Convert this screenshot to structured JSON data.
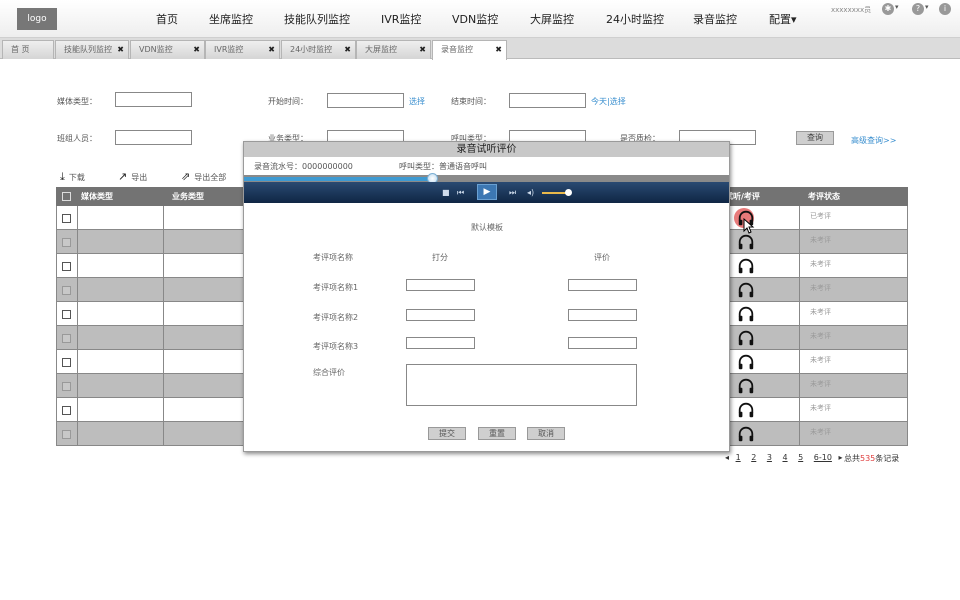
{
  "logo": "logo",
  "nav": [
    "首页",
    "坐席监控",
    "技能队列监控",
    "IVR监控",
    "VDN监控",
    "大屏监控",
    "24小时监控",
    "录音监控",
    "配置▾"
  ],
  "top": {
    "user": "xxxxxxxx员"
  },
  "tabs": [
    {
      "label": "首 页",
      "closable": false
    },
    {
      "label": "技能队列监控",
      "closable": true
    },
    {
      "label": "VDN监控",
      "closable": true
    },
    {
      "label": "IVR监控",
      "closable": true
    },
    {
      "label": "24小时监控",
      "closable": true
    },
    {
      "label": "大屏监控",
      "closable": true
    },
    {
      "label": "录音监控",
      "closable": true,
      "active": true
    }
  ],
  "close_glyph": "✖",
  "filters": {
    "media_type": "媒体类型：",
    "start_time": "开始时间：",
    "select": "选择",
    "end_time": "结束时间：",
    "today_select": "今天|选择",
    "team_member": "班组人员：",
    "business_type": "业务类型：",
    "call_type": "呼叫类型：",
    "qc": "是否质检：",
    "query": "查询",
    "advanced": "高级查询>>"
  },
  "toolbar": {
    "download": "下载",
    "export": "导出",
    "export_all": "导出全部"
  },
  "table": {
    "headers": [
      "媒体类型",
      "业务类型",
      "试听/考评",
      "考评状态"
    ],
    "rows": [
      {
        "status": "已考评"
      },
      {
        "status": "未考评"
      },
      {
        "status": "未考评"
      },
      {
        "status": "未考评"
      },
      {
        "status": "未考评"
      },
      {
        "status": "未考评"
      },
      {
        "status": "未考评"
      },
      {
        "status": "未考评"
      },
      {
        "status": "未考评"
      },
      {
        "status": "未考评"
      }
    ]
  },
  "pager": {
    "prev": "◂",
    "pages": [
      "1",
      "2",
      "3",
      "4",
      "5",
      "6-10"
    ],
    "next": "▸",
    "total_prefix": "总共",
    "total_count": "535",
    "total_suffix": "条记录"
  },
  "modal": {
    "title": "录音试听评价",
    "serial": "录音流水号：0000000000",
    "call_type": "呼叫类型：普通语音呼叫",
    "progress": 0.39,
    "template": "默认模板",
    "col_name": "考评项名称",
    "col_score": "打分",
    "col_eval": "评价",
    "items": [
      "考评项名称1",
      "考评项名称2",
      "考评项名称3"
    ],
    "overall": "综合评价",
    "submit": "提交",
    "reset": "重置",
    "cancel": "取消",
    "player_icons": {
      "stop": "■",
      "prev": "⏮",
      "play": "▶",
      "next": "⏭",
      "volume": "◂)"
    }
  },
  "accent_color": "#3a8fcf"
}
